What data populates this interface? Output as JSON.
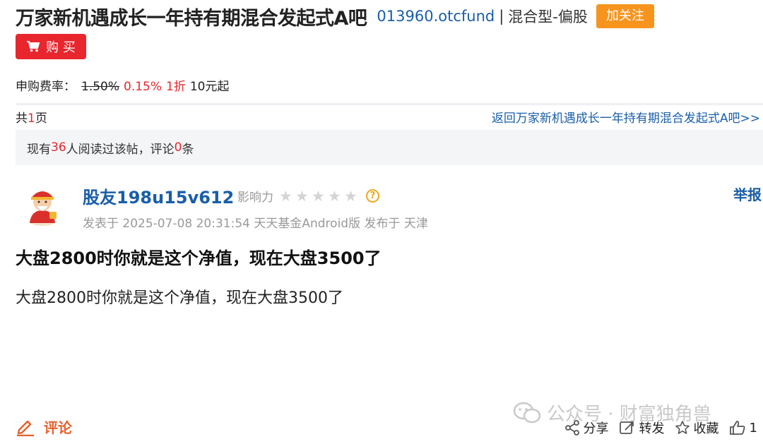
{
  "header": {
    "bar_title": "万家新机遇成长一年持有期混合发起式A吧",
    "fund_code": "013960.otcfund",
    "separator": "|",
    "fund_type": "混合型-偏股",
    "follow_label": "加关注"
  },
  "buy": {
    "label": "购 买",
    "icon": "cart-icon"
  },
  "fee": {
    "label": "申购费率：",
    "original_rate": "1.50%",
    "discount_rate": "0.15%",
    "discount": "1折",
    "minimum": "10元起"
  },
  "pagination": {
    "prefix": "共",
    "count": "1",
    "suffix": "页",
    "back_link": "返回万家新机遇成长一年持有期混合发起式A吧>>"
  },
  "read_info": {
    "prefix": "现有",
    "readers": "36",
    "middle": "人阅读过该帖，评论",
    "comments": "0",
    "suffix": "条"
  },
  "post": {
    "author": "股友198u15v612",
    "influence_label": "影响力",
    "influence_stars": 0,
    "influence_max": 5,
    "report_label": "举报",
    "meta": "发表于 2025-07-08 20:31:54 天天基金Android版 发布于 天津",
    "title": "大盘2800时你就是这个净值，现在大盘3500了",
    "body": "大盘2800时你就是这个净值，现在大盘3500了"
  },
  "footer": {
    "comment_label": "评论",
    "watermark": "公众号 · 财富独角兽",
    "share_label": "分享",
    "forward_label": "转发",
    "favorite_label": "收藏",
    "like_count": "1"
  },
  "colors": {
    "link_blue": "#1a5ea8",
    "accent_red": "#e8262d",
    "follow_orange": "#f7941d"
  }
}
